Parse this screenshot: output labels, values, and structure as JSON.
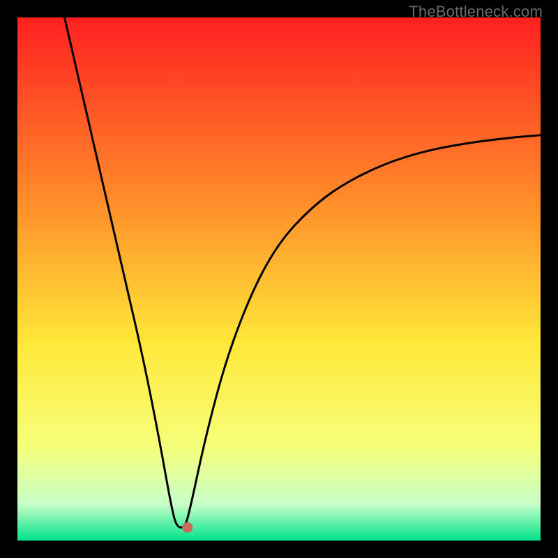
{
  "watermark": "TheBottleneck.com",
  "chart_data": {
    "type": "line",
    "title": "",
    "xlabel": "",
    "ylabel": "",
    "xlim": [
      0,
      100
    ],
    "ylim": [
      0,
      100
    ],
    "grid": false,
    "legend": false,
    "background_gradient": {
      "top": "#fe2020",
      "mid_upper": "#ff8c2a",
      "mid": "#ffe738",
      "mid_lower": "#f6ff7a",
      "lower": "#c8ffc8",
      "bottom": "#00e28a"
    },
    "series": [
      {
        "name": "bottleneck-curve",
        "x": [
          9,
          12,
          15,
          18,
          21,
          24,
          27,
          29.5,
          30.5,
          32,
          33,
          36,
          40,
          45,
          50,
          56,
          62,
          70,
          78,
          86,
          94,
          100
        ],
        "y": [
          100,
          87,
          74,
          61,
          48,
          35,
          20,
          6,
          2.5,
          2.5,
          6,
          20,
          35,
          48,
          57,
          63.5,
          68,
          72,
          74.5,
          76,
          77,
          77.5
        ]
      }
    ],
    "marker": {
      "name": "optimal-point",
      "x": 32.5,
      "y": 2.5,
      "color": "#c96a5e",
      "radius_pct": 1.0
    },
    "plot_area_border_color": "#000000",
    "plot_area_border_width_px": 25
  }
}
